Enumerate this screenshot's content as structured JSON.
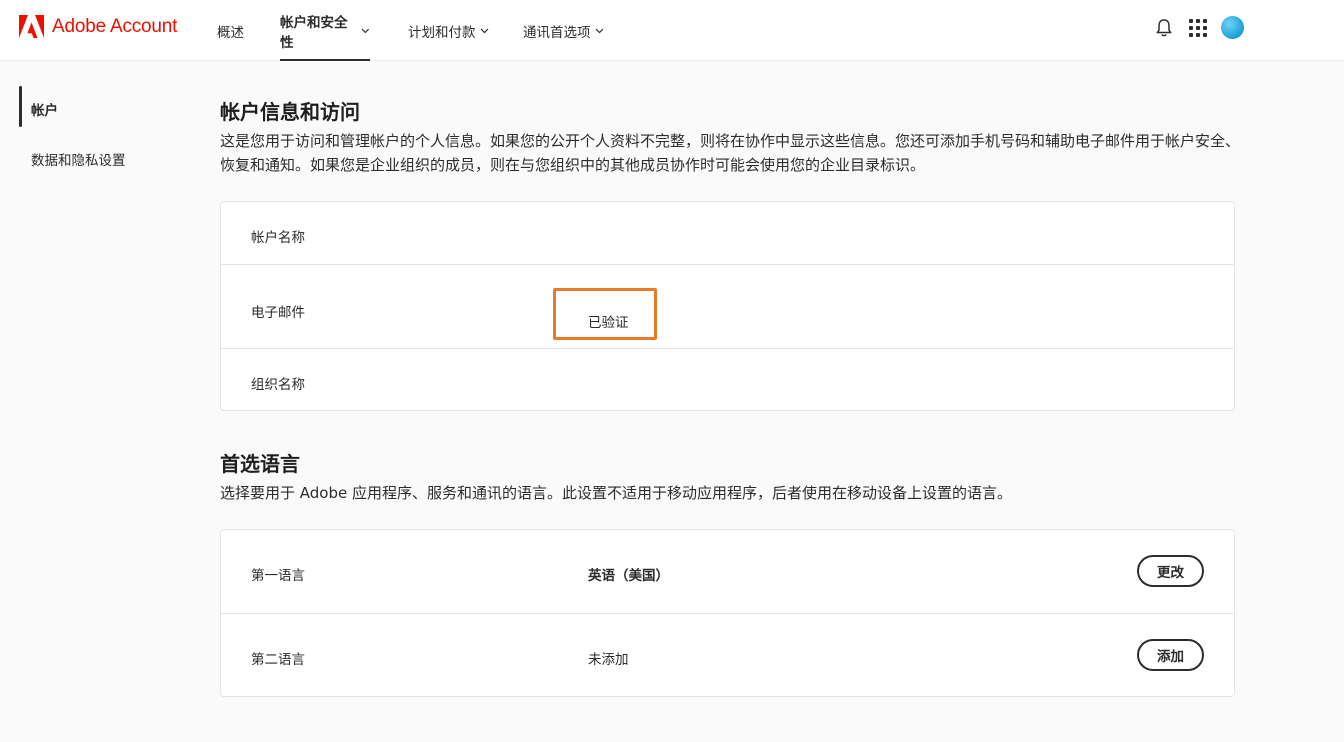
{
  "app": {
    "brand": "Adobe Account",
    "brand_color": "#eb1000"
  },
  "nav": {
    "items": [
      {
        "label": "概述",
        "active": false,
        "has_menu": false
      },
      {
        "label": "帐户和安全性",
        "active": true,
        "has_menu": true
      },
      {
        "label": "计划和付款",
        "active": false,
        "has_menu": true
      },
      {
        "label": "通讯首选项",
        "active": false,
        "has_menu": true
      }
    ],
    "icons": [
      "bell-icon",
      "apps-grid-icon",
      "avatar"
    ]
  },
  "sidebar": {
    "items": [
      {
        "label": "帐户",
        "active": true
      },
      {
        "label": "数据和隐私设置",
        "active": false
      }
    ]
  },
  "account_section": {
    "title": "帐户信息和访问",
    "description": "这是您用于访问和管理帐户的个人信息。如果您的公开个人资料不完整，则将在协作中显示这些信息。您还可添加手机号码和辅助电子邮件用于帐户安全、恢复和通知。如果您是企业组织的成员，则在与您组织中的其他成员协作时可能会使用您的企业目录标识。",
    "rows": [
      {
        "label": "帐户名称",
        "value": ""
      },
      {
        "label": "电子邮件",
        "value": "已验证",
        "highlight_color": "#e87a2a"
      },
      {
        "label": "组织名称",
        "value": ""
      }
    ]
  },
  "language_section": {
    "title": "首选语言",
    "description": "选择要用于 Adobe 应用程序、服务和通讯的语言。此设置不适用于移动应用程序，后者使用在移动设备上设置的语言。",
    "rows": [
      {
        "label": "第一语言",
        "value": "英语（美国）",
        "button": "更改"
      },
      {
        "label": "第二语言",
        "value": "未添加",
        "button": "添加"
      }
    ]
  }
}
